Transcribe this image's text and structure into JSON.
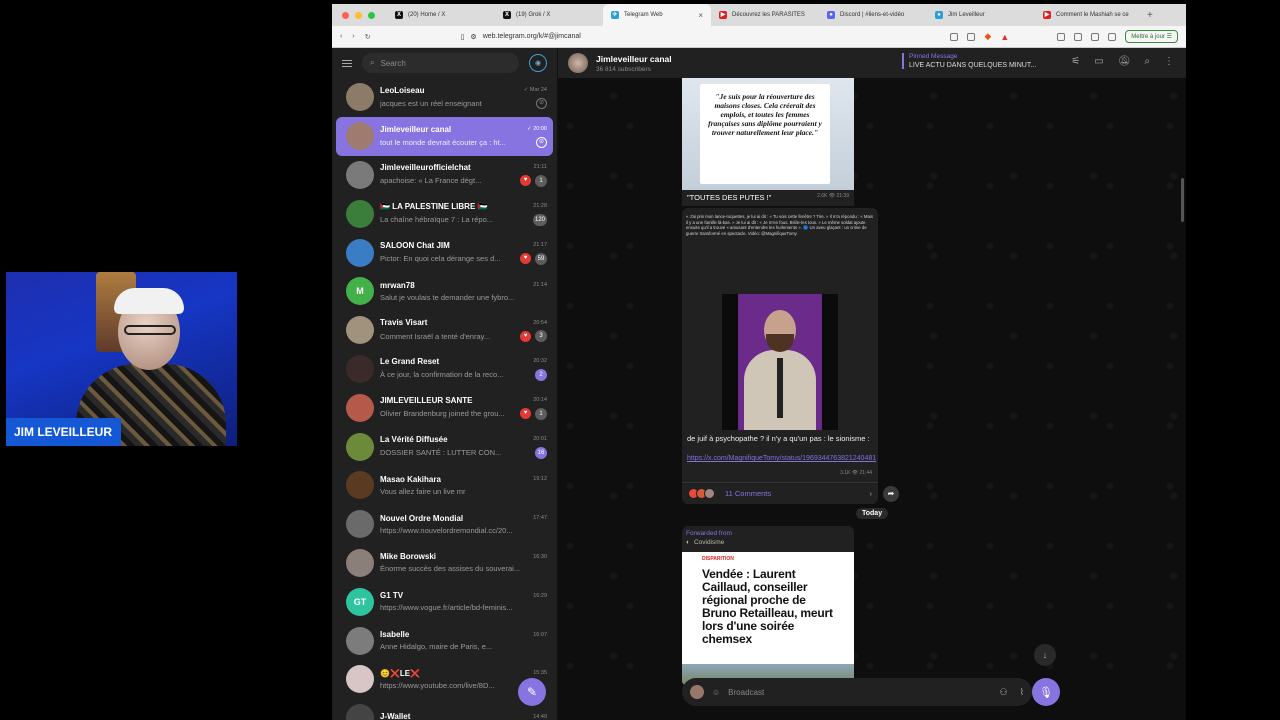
{
  "webcam": {
    "name": "JIM LEVEILLEUR"
  },
  "browser": {
    "tabs": [
      {
        "label": "(20) Home / X",
        "fav": "X",
        "color": "#111111"
      },
      {
        "label": "(19) Grok / X",
        "fav": "X",
        "color": "#111111"
      },
      {
        "label": "Telegram Web",
        "fav": "✈",
        "color": "#2a9fd8",
        "active": true
      },
      {
        "label": "Découvrez les PARASITES",
        "fav": "▶",
        "color": "#e02020"
      },
      {
        "label": "Discord | #liens-et-vidéo",
        "fav": "●",
        "color": "#5865f2"
      },
      {
        "label": "Jim Leveilleur",
        "fav": "●",
        "color": "#2a9fd8"
      },
      {
        "label": "Comment le Mashiah se ce",
        "fav": "▶",
        "color": "#e02020"
      }
    ],
    "url": "web.telegram.org/k/#@jimcanal",
    "update_label": "Mettre à jour"
  },
  "sidebar": {
    "search_placeholder": "Search",
    "chats": [
      {
        "name": "LeoLoiseau",
        "time": "✓ Mar 24",
        "preview": "jacques est un réel enseignant",
        "color": "#8d7b6a",
        "indicator": "pin"
      },
      {
        "name": "Jimleveilleur canal",
        "time": "✓ 20:00",
        "preview": "tout le monde devrait écouter ça : ht...",
        "color": "#9e7b6e",
        "active": true,
        "indicator": "pin"
      },
      {
        "name": "Jimleveilleurofficielchat",
        "time": "21:11",
        "preview": "apachoise: « La France dégt...",
        "color": "#7a7a7a",
        "heart": true,
        "badge": "1"
      },
      {
        "name": "🇵🇸 LA PALESTINE LIBRE 🇵🇸",
        "time": "21:28",
        "preview": "La chaîne hébraïque 7 : La répo...",
        "color": "#3b7d3b",
        "badge": "120"
      },
      {
        "name": "SALOON Chat JIM",
        "time": "21:17",
        "preview": "Pictor: En quoi cela dérange ses d...",
        "color": "#3a7dc4",
        "heart": true,
        "badge": "59"
      },
      {
        "name": "mrwan78",
        "time": "21:14",
        "preview": "Salut je voulais te demander une fybro...",
        "color": "#43b04a",
        "letter": "M"
      },
      {
        "name": "Travis Visart",
        "time": "20:54",
        "preview": "Comment Israël a tenté d'enray...",
        "color": "#a1927e",
        "heart": true,
        "badge": "3"
      },
      {
        "name": "Le Grand Reset",
        "time": "20:32",
        "preview": "À ce jour, la confirmation de la reco...",
        "color": "#3a2a2a",
        "badge": "2",
        "purple": true
      },
      {
        "name": "JIMLEVEILLEUR SANTE",
        "time": "20:14",
        "preview": "Olivier Brandenburg joined the grou...",
        "color": "#b55a4a",
        "heart": true,
        "badge": "1"
      },
      {
        "name": "La Vérité Diffusée",
        "time": "20:01",
        "preview": "DOSSIER SANTÉ : LUTTER CON...",
        "color": "#6b8b3a",
        "badge": "16",
        "purple": true
      },
      {
        "name": "Masao Kakihara",
        "time": "19:12",
        "preview": "Vous allez faire un live mr",
        "color": "#5a3a20"
      },
      {
        "name": "Nouvel Ordre Mondial",
        "time": "17:47",
        "preview": "https://www.nouvelordremondial.cc/20...",
        "color": "#6a6a6a"
      },
      {
        "name": "Mike Borowski",
        "time": "16:30",
        "preview": "Énorme succès des assises du souverai...",
        "color": "#8a7f79"
      },
      {
        "name": "G1 TV",
        "time": "16:29",
        "preview": "https://www.vogue.fr/article/bd-feminis...",
        "color": "#2fc4a0",
        "letter": "GT"
      },
      {
        "name": "Isabelle",
        "time": "16:07",
        "preview": "Anne Hidalgo, maire de Paris, e...",
        "color": "#7c7c7c"
      },
      {
        "name": "😊❌LE❌",
        "time": "15:35",
        "preview": "https://www.youtube.com/live/8D...",
        "color": "#d8c6c6"
      },
      {
        "name": "J-Wallet",
        "time": "14:49",
        "preview": "",
        "color": "#444444"
      }
    ]
  },
  "channel": {
    "title": "Jimleveilleur canal",
    "subscribers": "36 814 subscribers",
    "pinned_label": "Pinned Message",
    "pinned_text": "LIVE ACTU DANS QUELQUES MINUT..."
  },
  "messages": {
    "quote": "\"Je suis pour la réouverture des maisons closes. Cela créerait des emplois, et toutes les femmes françaises sans diplôme pourraient y trouver naturellement leur place.\"",
    "caption1": "\"TOUTES DES PUTES !\"",
    "meta1": "2.6K 👁 21:39",
    "small_text": "« J'ai pris mon lance-roquettes, je lui ai dit : « Tu vois cette fenêtre ? Tire. » Il m'a répondu : « Mais il y a une famille là-bas. » Je lui ai dit : « Je m'en fous. Brûle-les tous. » Le même soldat ajoute ensuite qu'il a trouvé « amusant d'entendre les hurlements ». 🔵 Un aveu glaçant : un crime de guerre transformé en spectacle. Vidéo: @MagnifiqueTomy",
    "caption2": "de juif à psychopathe ? il n'y a qu'un pas : le sionisme :",
    "link2": "https://x.com/MagnifiqueTomy/status/1969344763821240481",
    "meta2": "3.1K 👁 21:44",
    "comments": "11 Comments",
    "today": "Today",
    "fwd_label": "Forwarded from",
    "fwd_name": "Covidisme",
    "news_tag": "DISPARITION",
    "news_title": "Vendée : Laurent Caillaud, conseiller régional proche de Bruno Retailleau, meurt lors d'une soirée chemsex",
    "composer_placeholder": "Broadcast"
  }
}
